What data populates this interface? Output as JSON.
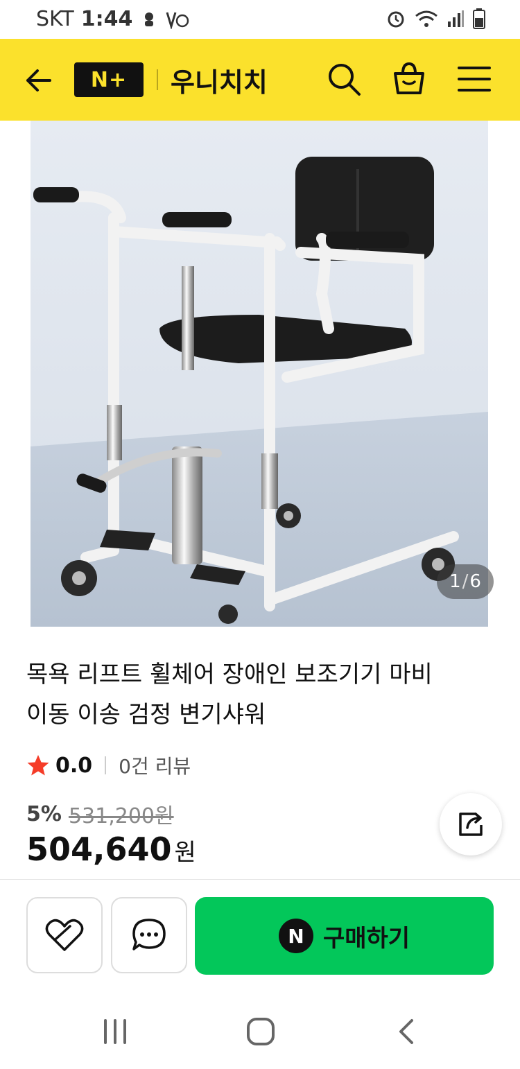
{
  "status_bar": {
    "carrier": "SKT",
    "time": "1:44"
  },
  "header": {
    "logo_text": "N+",
    "store_name": "우니치치",
    "bg_color": "#fbe12c"
  },
  "gallery": {
    "current": "1",
    "separator": "/",
    "total": "6"
  },
  "product": {
    "title_line1": "목욕 리프트 휠체어 장애인 보조기기 마비",
    "title_line2": "이동 이송 검정 변기샤워",
    "rating": "0.0",
    "review_text": "0건 리뷰",
    "discount_rate": "5%",
    "original_price": "531,200원",
    "price": "504,640",
    "currency": "원"
  },
  "actions": {
    "buy_label": "구매하기",
    "buy_badge": "N",
    "buy_color": "#03c75a"
  },
  "icons": [
    "back-arrow-icon",
    "search-icon",
    "shopping-bag-icon",
    "menu-icon",
    "star-icon",
    "share-icon",
    "wishlist-heart-icon",
    "chat-icon"
  ]
}
